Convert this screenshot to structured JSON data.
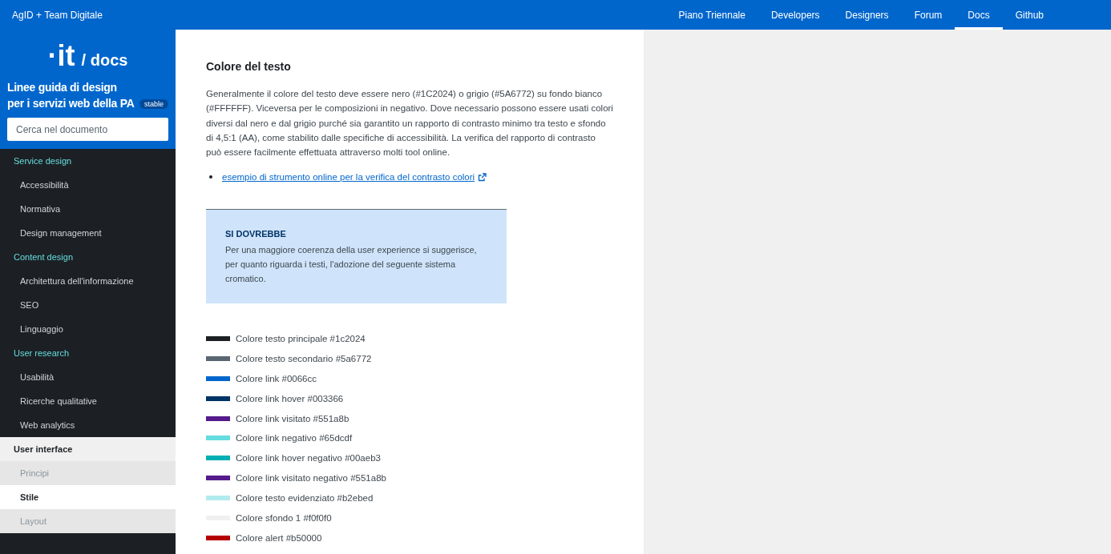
{
  "header": {
    "brand": "AgID + Team Digitale",
    "nav": [
      {
        "label": "Piano Triennale",
        "selected": false
      },
      {
        "label": "Developers",
        "selected": false
      },
      {
        "label": "Designers",
        "selected": false
      },
      {
        "label": "Forum",
        "selected": false
      },
      {
        "label": "Docs",
        "selected": true
      },
      {
        "label": "Github",
        "selected": false
      }
    ]
  },
  "sidebar": {
    "logo": "·it",
    "logo_suffix": "/ docs",
    "title": "Linee guida di design per i servizi web della PA",
    "badge": "stable",
    "search": {
      "placeholder": "Cerca nel documento"
    },
    "groups": [
      {
        "label": "Service design",
        "selected": false,
        "children": [
          {
            "label": "Accessibilità",
            "selected": false
          },
          {
            "label": "Normativa",
            "selected": false
          },
          {
            "label": "Design management",
            "selected": false
          }
        ]
      },
      {
        "label": "Content design",
        "selected": false,
        "children": [
          {
            "label": "Architettura dell'informazione",
            "selected": false
          },
          {
            "label": "SEO",
            "selected": false
          },
          {
            "label": "Linguaggio",
            "selected": false
          }
        ]
      },
      {
        "label": "User research",
        "selected": false,
        "children": [
          {
            "label": "Usabilità",
            "selected": false
          },
          {
            "label": "Ricerche qualitative",
            "selected": false
          },
          {
            "label": "Web analytics",
            "selected": false
          }
        ]
      },
      {
        "label": "User interface",
        "selected": true,
        "children": [
          {
            "label": "Principi",
            "selected": false
          },
          {
            "label": "Stile",
            "selected": true
          },
          {
            "label": "Layout",
            "selected": false
          }
        ]
      }
    ]
  },
  "content": {
    "heading": "Colore del testo",
    "paragraph": "Generalmente il colore del testo deve essere nero (#1C2024) o grigio (#5A6772) su fondo bianco (#FFFFFF). Viceversa per le composizioni in negativo. Dove necessario possono essere usati colori diversi dal nero e dal grigio purché sia garantito un rapporto di contrasto minimo tra testo e sfondo di 4,5:1 (AA), come stabilito dalle specifiche di accessibilità. La verifica del rapporto di contrasto può essere facilmente effettuata attraverso molti tool online.",
    "links": [
      "esempio di strumento online per la verifica del contrasto colori"
    ],
    "callout": {
      "title": "SI DOVREBBE",
      "text": "Per una maggiore coerenza della user experience si suggerisce, per quanto riguarda i testi, l'adozione del seguente sistema cromatico."
    },
    "swatches": [
      {
        "label": "Colore testo principale #1c2024",
        "color": "#1c2024"
      },
      {
        "label": "Colore testo secondario #5a6772",
        "color": "#5a6772"
      },
      {
        "label": "Colore link #0066cc",
        "color": "#0066cc"
      },
      {
        "label": "Colore link hover #003366",
        "color": "#003366"
      },
      {
        "label": "Colore link visitato #551a8b",
        "color": "#551a8b"
      },
      {
        "label": "Colore link negativo #65dcdf",
        "color": "#65dcdf"
      },
      {
        "label": "Colore link hover negativo #00aeb3",
        "color": "#00aeb3"
      },
      {
        "label": "Colore link visitato negativo #551a8b",
        "color": "#551a8b"
      },
      {
        "label": "Colore testo evidenziato #b2ebed",
        "color": "#b2ebed"
      },
      {
        "label": "Colore sfondo 1 #f0f0f0",
        "color": "#f0f0f0"
      },
      {
        "label": "Colore alert #b50000",
        "color": "#b50000"
      }
    ]
  }
}
